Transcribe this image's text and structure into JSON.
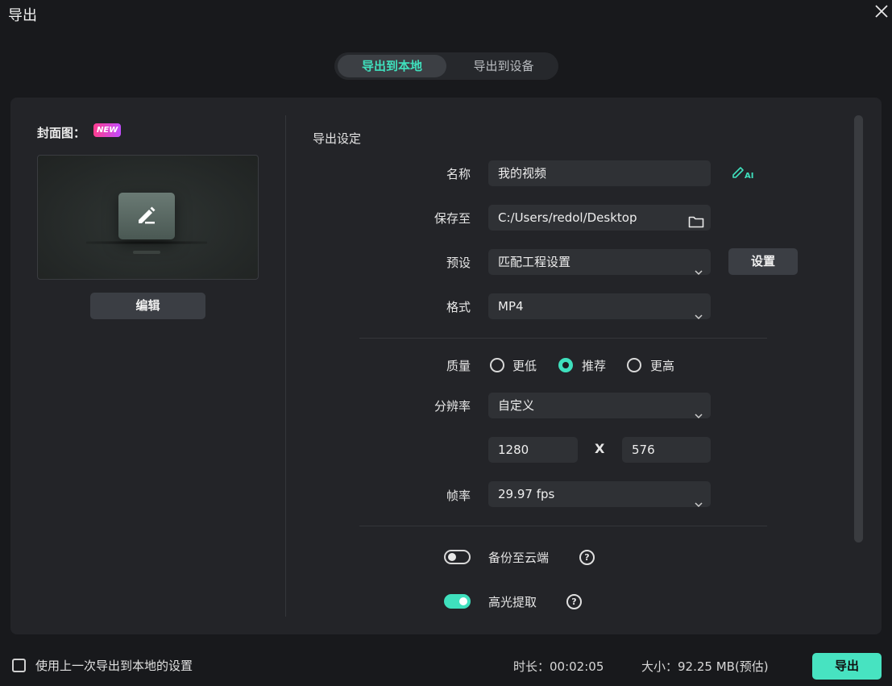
{
  "window": {
    "title": "导出",
    "close_icon": "close-icon"
  },
  "tabs": [
    {
      "label": "导出到本地",
      "active": true
    },
    {
      "label": "导出到设备",
      "active": false
    }
  ],
  "cover": {
    "label": "封面图：",
    "badge": "NEW",
    "edit_button": "编辑",
    "icon": "pencil-icon"
  },
  "settings": {
    "section_title": "导出设定",
    "name": {
      "label": "名称",
      "value": "我的视频",
      "ai_icon": "ai-edit-icon"
    },
    "save_to": {
      "label": "保存至",
      "value": "C:/Users/redol/Desktop",
      "icon": "folder-icon"
    },
    "preset": {
      "label": "预设",
      "value": "匹配工程设置",
      "button": "设置"
    },
    "format": {
      "label": "格式",
      "value": "MP4"
    },
    "quality": {
      "label": "质量",
      "options": [
        "更低",
        "推荐",
        "更高"
      ],
      "selected": "推荐"
    },
    "resolution": {
      "label": "分辨率",
      "value": "自定义",
      "width": "1280",
      "separator": "X",
      "height": "576"
    },
    "framerate": {
      "label": "帧率",
      "value": "29.97 fps"
    },
    "backup": {
      "label": "备份至云端",
      "enabled": false
    },
    "highlight": {
      "label": "高光提取",
      "enabled": true
    }
  },
  "footer": {
    "use_last_label": "使用上一次导出到本地的设置",
    "duration": "时长：00:02:05",
    "size": "大小：92.25 MB(预估)",
    "export_button": "导出"
  },
  "colors": {
    "accent": "#3fe0bd",
    "background": "#18191c",
    "panel": "#232428",
    "field": "#2f3135"
  }
}
